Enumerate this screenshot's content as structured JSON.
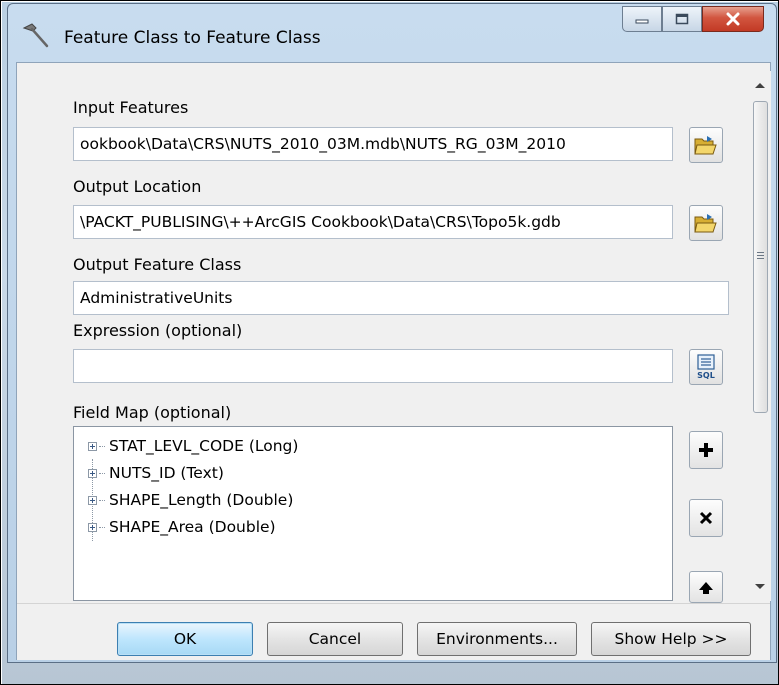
{
  "window": {
    "title": "Feature Class to Feature Class",
    "icon": "hammer-icon",
    "controls": [
      "minimize-icon",
      "maximize-icon",
      "close-icon"
    ]
  },
  "form": {
    "input_features": {
      "label": "Input Features",
      "value": "ookbook\\Data\\CRS\\NUTS_2010_03M.mdb\\NUTS_RG_03M_2010"
    },
    "output_location": {
      "label": "Output Location",
      "value": "\\PACKT_PUBLISING\\++ArcGIS Cookbook\\Data\\CRS\\Topo5k.gdb"
    },
    "output_feature_class": {
      "label": "Output Feature Class",
      "value": "AdministrativeUnits"
    },
    "expression": {
      "label": "Expression (optional)",
      "value": "",
      "sql_icon_text": "SQL"
    },
    "field_map": {
      "label": "Field Map (optional)",
      "items": [
        "STAT_LEVL_CODE (Long)",
        "NUTS_ID (Text)",
        "SHAPE_Length (Double)",
        "SHAPE_Area (Double)"
      ]
    }
  },
  "buttons": {
    "ok": "OK",
    "cancel": "Cancel",
    "environments": "Environments...",
    "show_help": "Show Help >>"
  },
  "colors": {
    "default_button": "#bee6fd",
    "close_button": "#c23a25",
    "folder": "#e9c54a"
  }
}
